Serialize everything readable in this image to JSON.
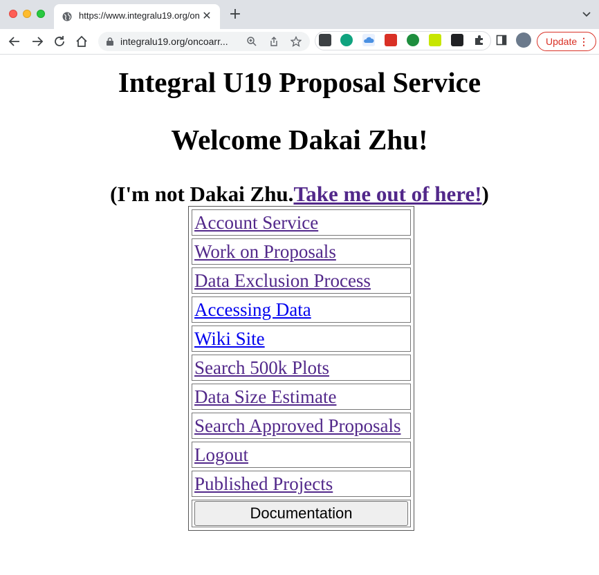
{
  "browser": {
    "tab_title": "https://www.integralu19.org/on",
    "url": "integralu19.org/oncoarr...",
    "update_label": "Update",
    "colors": {
      "update_red": "#d93025",
      "tabbar": "#dee1e6"
    }
  },
  "page": {
    "title": "Integral U19 Proposal Service",
    "welcome": "Welcome Dakai Zhu!",
    "not_me_prefix": "(I'm not Dakai Zhu.",
    "not_me_link": "Take me out of here!",
    "not_me_suffix": ")",
    "menu": [
      {
        "label": "Account Service",
        "visited": true
      },
      {
        "label": "Work on Proposals",
        "visited": true
      },
      {
        "label": "Data Exclusion Process",
        "visited": true
      },
      {
        "label": "Accessing Data",
        "visited": false
      },
      {
        "label": "Wiki Site",
        "visited": false
      },
      {
        "label": "Search 500k Plots",
        "visited": true
      },
      {
        "label": "Data Size Estimate",
        "visited": true
      },
      {
        "label": "Search Approved Proposals",
        "visited": true
      },
      {
        "label": "Logout",
        "visited": true
      },
      {
        "label": "Published Projects",
        "visited": true
      }
    ],
    "documentation_label": "Documentation",
    "colors": {
      "visited_link": "#52288a",
      "unvisited_link": "#0000ee"
    }
  }
}
